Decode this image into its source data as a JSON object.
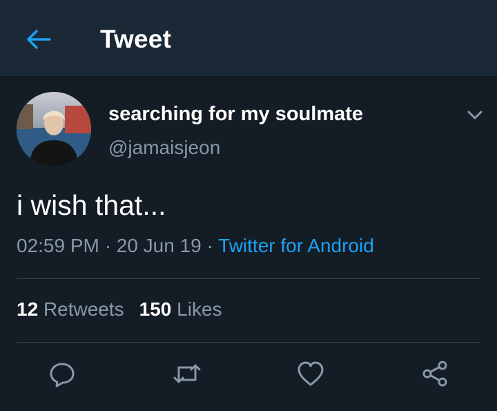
{
  "header": {
    "title": "Tweet",
    "back_icon": "arrow-left-icon",
    "accent": "#1da1f2"
  },
  "tweet": {
    "display_name": "searching for my soulmate",
    "handle": "@jamaisjeon",
    "text": "i wish that...",
    "time": "02:59 PM",
    "date": "20 Jun 19",
    "separator": "·",
    "source": "Twitter for Android",
    "menu_icon": "chevron-down-icon"
  },
  "stats": {
    "retweets_count": "12",
    "retweets_label": "Retweets",
    "likes_count": "150",
    "likes_label": "Likes"
  },
  "actions": [
    {
      "icon": "reply-icon"
    },
    {
      "icon": "retweet-icon"
    },
    {
      "icon": "like-icon"
    },
    {
      "icon": "share-icon"
    }
  ],
  "colors": {
    "background": "#141d26",
    "header_background": "#1b2836",
    "secondary_text": "#8899a6",
    "link": "#1da1f2",
    "divider": "#38444d"
  }
}
